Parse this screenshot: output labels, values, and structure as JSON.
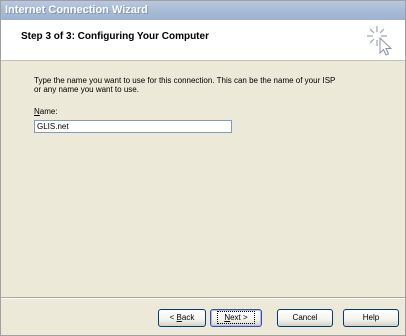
{
  "window": {
    "title": "Internet Connection Wizard"
  },
  "header": {
    "title": "Step 3 of 3: Configuring Your Computer",
    "icon": "wizard-cursor-icon"
  },
  "main": {
    "instruction_line1": "Type the name you want to use for this connection. This can be the name of your ISP",
    "instruction_line2": "or any name you want to use.",
    "name_label_accel": "N",
    "name_label_rest": "ame:",
    "name_value": "GLIS.net"
  },
  "buttons": {
    "back_prefix": "< ",
    "back_accel": "B",
    "back_rest": "ack",
    "next_accel": "N",
    "next_rest": "ext >",
    "cancel": "Cancel",
    "help": "Help"
  },
  "colors": {
    "titlebar": "#a9bbd6",
    "dialog_bg": "#ece9d8",
    "header_bg": "#ffffff"
  }
}
